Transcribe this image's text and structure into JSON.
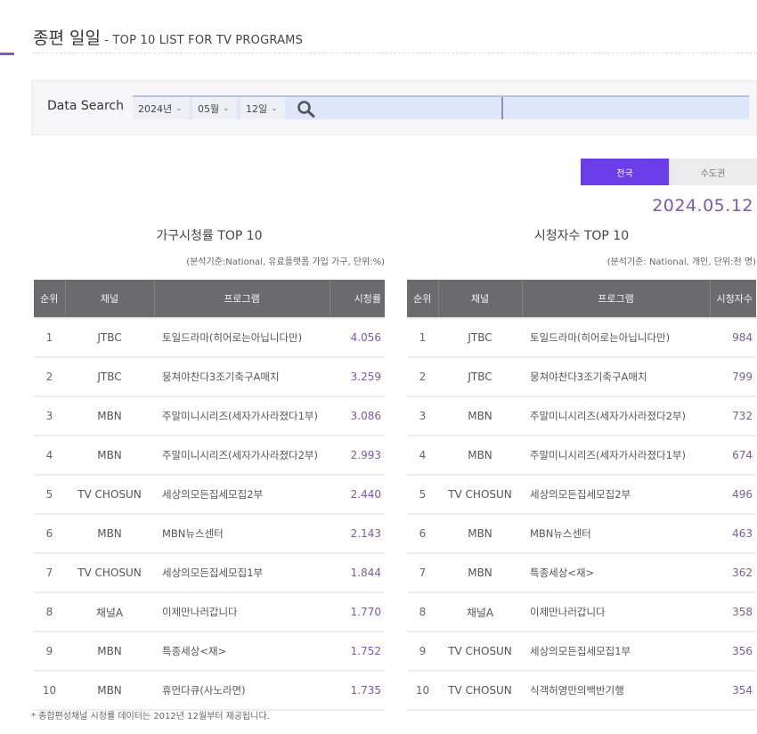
{
  "header": {
    "title_ko": "종편 일일",
    "title_sub": " - TOP 10 LIST FOR TV PROGRAMS"
  },
  "search": {
    "label": "Data Search",
    "year": "2024년",
    "month": "05월",
    "day": "12일",
    "icon": "search-icon",
    "chevron": "⌄"
  },
  "region_tabs": [
    {
      "label": "전국",
      "active": true
    },
    {
      "label": "수도권",
      "active": false
    }
  ],
  "date": "2024.05.12",
  "colors": {
    "accent": "#6a3ee8",
    "value_text": "#7b5aa6",
    "header_bg": "#6b6b6f"
  },
  "household": {
    "title": "가구시청률 TOP 10",
    "note": "(분석기준:National, 유료플랫폼 가입 가구, 단위:%)",
    "columns": [
      "순위",
      "채널",
      "프로그램",
      "시청률"
    ],
    "rows": [
      {
        "rank": "1",
        "channel": "JTBC",
        "program": "토일드라마(히어로는아닙니다만)",
        "value": "4.056"
      },
      {
        "rank": "2",
        "channel": "JTBC",
        "program": "뭉쳐야찬다3조기축구A매치",
        "value": "3.259"
      },
      {
        "rank": "3",
        "channel": "MBN",
        "program": "주말미니시리즈(세자가사라졌다1부)",
        "value": "3.086"
      },
      {
        "rank": "4",
        "channel": "MBN",
        "program": "주말미니시리즈(세자가사라졌다2부)",
        "value": "2.993"
      },
      {
        "rank": "5",
        "channel": "TV CHOSUN",
        "program": "세상의모든집세모집2부",
        "value": "2.440"
      },
      {
        "rank": "6",
        "channel": "MBN",
        "program": "MBN뉴스센터",
        "value": "2.143"
      },
      {
        "rank": "7",
        "channel": "TV CHOSUN",
        "program": "세상의모든집세모집1부",
        "value": "1.844"
      },
      {
        "rank": "8",
        "channel": "채널A",
        "program": "이제만나러갑니다",
        "value": "1.770"
      },
      {
        "rank": "9",
        "channel": "MBN",
        "program": "특종세상<재>",
        "value": "1.752"
      },
      {
        "rank": "10",
        "channel": "MBN",
        "program": "휴먼다큐(사노라면)",
        "value": "1.735"
      }
    ]
  },
  "viewers": {
    "title": "시청자수 TOP 10",
    "note": "(분석기준: National, 개인, 단위:천 명)",
    "columns": [
      "순위",
      "채널",
      "프로그램",
      "시청자수"
    ],
    "rows": [
      {
        "rank": "1",
        "channel": "JTBC",
        "program": "토일드라마(히어로는아닙니다만)",
        "value": "984"
      },
      {
        "rank": "2",
        "channel": "JTBC",
        "program": "뭉쳐야찬다3조기축구A매치",
        "value": "799"
      },
      {
        "rank": "3",
        "channel": "MBN",
        "program": "주말미니시리즈(세자가사라졌다2부)",
        "value": "732"
      },
      {
        "rank": "4",
        "channel": "MBN",
        "program": "주말미니시리즈(세자가사라졌다1부)",
        "value": "674"
      },
      {
        "rank": "5",
        "channel": "TV CHOSUN",
        "program": "세상의모든집세모집2부",
        "value": "496"
      },
      {
        "rank": "6",
        "channel": "MBN",
        "program": "MBN뉴스센터",
        "value": "463"
      },
      {
        "rank": "7",
        "channel": "MBN",
        "program": "특종세상<재>",
        "value": "362"
      },
      {
        "rank": "8",
        "channel": "채널A",
        "program": "이제만나러갑니다",
        "value": "358"
      },
      {
        "rank": "9",
        "channel": "TV CHOSUN",
        "program": "세상의모든집세모집1부",
        "value": "356"
      },
      {
        "rank": "10",
        "channel": "TV CHOSUN",
        "program": "식객허영만의백반기행",
        "value": "354"
      }
    ]
  },
  "footnote": "* 종합편성채널 시청률 데이터는 2012년 12월부터 제공됩니다."
}
